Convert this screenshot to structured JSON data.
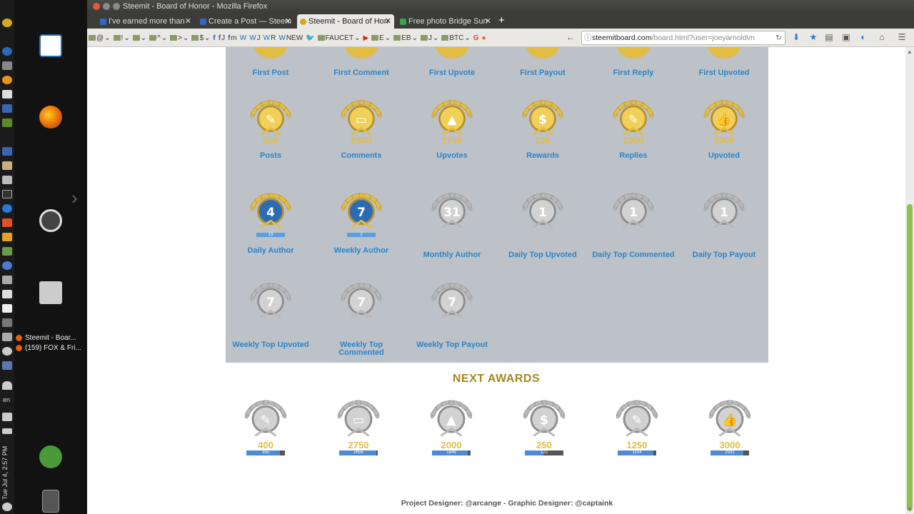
{
  "window": {
    "title": "Steemit - Board of Honor - Mozilla Firefox"
  },
  "tabs": [
    {
      "label": "I've earned more than",
      "color": "#3366cc"
    },
    {
      "label": "Create a Post — Steem",
      "color": "#3366cc"
    },
    {
      "label": "Steemit - Board of Hon",
      "color": "#d6a81e",
      "active": true
    },
    {
      "label": "Free photo Bridge Sun",
      "color": "#3aa64a"
    }
  ],
  "bookmarks": [
    "@",
    "!",
    "",
    "^",
    ">",
    "$",
    "",
    "J",
    "m",
    "W",
    "J",
    "R",
    "NEW",
    "",
    "FAUCET",
    "",
    "E",
    "EB",
    "J",
    "BTC",
    "G",
    ""
  ],
  "url": {
    "domain": "steemitboard.com",
    "path": "/board.html?user=joeyarnoldvn"
  },
  "board": {
    "top_row": [
      "First Post",
      "First Comment",
      "First Upvote",
      "First Payout",
      "First Reply",
      "First Upvoted"
    ],
    "count_row": [
      {
        "label": "Posts",
        "value": "350",
        "icon": "feather-icon"
      },
      {
        "label": "Comments",
        "value": "2500",
        "icon": "chat-icon"
      },
      {
        "label": "Upvotes",
        "value": "1750",
        "icon": "upvote-icon"
      },
      {
        "label": "Rewards",
        "value": "100",
        "icon": "dollar-icon"
      },
      {
        "label": "Replies",
        "value": "1000",
        "icon": "pencil-icon"
      },
      {
        "label": "Upvoted",
        "value": "2000",
        "icon": "thumbs-up-icon"
      }
    ],
    "author_row": [
      {
        "label": "Daily Author",
        "value": "4",
        "sub": "13",
        "style": "gold-blue"
      },
      {
        "label": "Weekly Author",
        "value": "7",
        "sub": "2",
        "style": "gold-blue"
      },
      {
        "label": "Monthly Author",
        "value": "31",
        "sub": "",
        "style": "silver"
      },
      {
        "label": "Daily Top Upvoted",
        "value": "1",
        "sub": "",
        "style": "silver"
      },
      {
        "label": "Daily Top Commented",
        "value": "1",
        "sub": "",
        "style": "silver"
      },
      {
        "label": "Daily Top Payout",
        "value": "1",
        "sub": "",
        "style": "silver"
      }
    ],
    "weekly_row": [
      {
        "label": "Weekly Top Upvoted",
        "value": "7"
      },
      {
        "label": "Weekly Top Commented",
        "value": "7"
      },
      {
        "label": "Weekly Top Payout",
        "value": "7"
      }
    ]
  },
  "next_awards": {
    "title": "NEXT AWARDS",
    "items": [
      {
        "target": "400",
        "current": "350",
        "progress": 0.875
      },
      {
        "target": "2750",
        "current": "2656",
        "progress": 0.966
      },
      {
        "target": "2000",
        "current": "1849",
        "progress": 0.92
      },
      {
        "target": "250",
        "current": "122",
        "progress": 0.49
      },
      {
        "target": "1250",
        "current": "1154",
        "progress": 0.92
      },
      {
        "target": "3000",
        "current": "2591",
        "progress": 0.86
      }
    ]
  },
  "footer": "Project Designer: @arcange - Graphic Designer: @captaink",
  "launcher": {
    "windows": [
      "Steemit - Boar...",
      "(159) FOX & Fri..."
    ],
    "lang": "en",
    "clock": "Tue Jul 4, 2:57 PM"
  },
  "colors": {
    "link": "#2a86c8",
    "gold": "#d9b23a",
    "board_bg": "#bdc1c8",
    "next_title": "#a4871e"
  }
}
